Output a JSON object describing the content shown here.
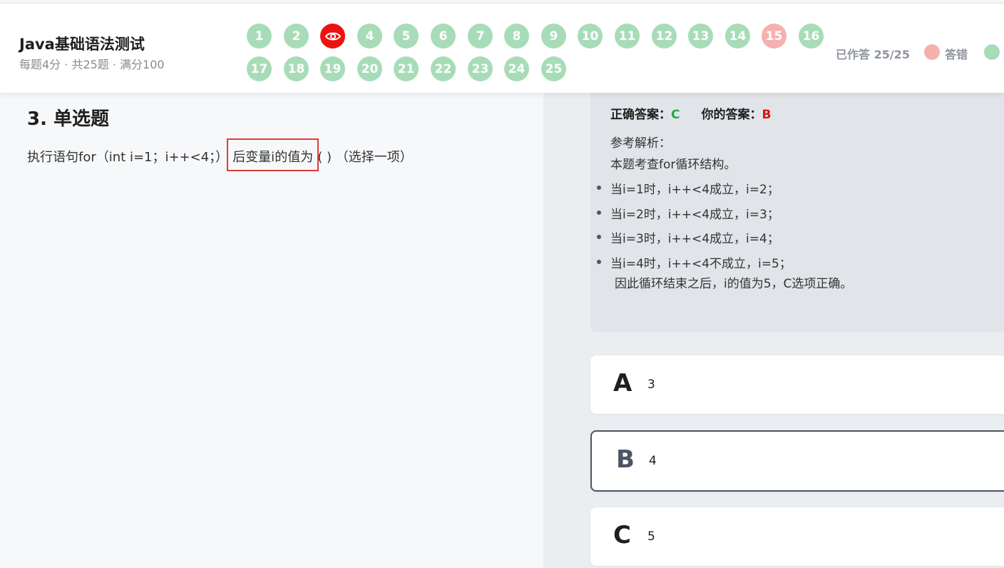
{
  "header": {
    "title": "Java基础语法测试",
    "subtitle": "每题4分 · 共25题 · 满分100",
    "answered": "已作答 25/25",
    "legend_wrong": "答错",
    "colors": {
      "correct": "#a8dcb8",
      "wrong": "#f5b0b0",
      "current": "#ee1111"
    }
  },
  "question_nav": [
    {
      "label": "1",
      "status": "correct"
    },
    {
      "label": "2",
      "status": "correct"
    },
    {
      "label": "",
      "status": "current",
      "icon": "eye-icon"
    },
    {
      "label": "4",
      "status": "correct"
    },
    {
      "label": "5",
      "status": "correct"
    },
    {
      "label": "6",
      "status": "correct"
    },
    {
      "label": "7",
      "status": "correct"
    },
    {
      "label": "8",
      "status": "correct"
    },
    {
      "label": "9",
      "status": "correct"
    },
    {
      "label": "10",
      "status": "correct"
    },
    {
      "label": "11",
      "status": "correct"
    },
    {
      "label": "12",
      "status": "correct"
    },
    {
      "label": "13",
      "status": "correct"
    },
    {
      "label": "14",
      "status": "correct"
    },
    {
      "label": "15",
      "status": "wrong"
    },
    {
      "label": "16",
      "status": "correct"
    },
    {
      "label": "17",
      "status": "correct"
    },
    {
      "label": "18",
      "status": "correct"
    },
    {
      "label": "19",
      "status": "correct"
    },
    {
      "label": "20",
      "status": "correct"
    },
    {
      "label": "21",
      "status": "correct"
    },
    {
      "label": "22",
      "status": "correct"
    },
    {
      "label": "23",
      "status": "correct"
    },
    {
      "label": "24",
      "status": "correct"
    },
    {
      "label": "25",
      "status": "correct"
    }
  ],
  "question": {
    "title": "3. 单选题",
    "stem_before": "执行语句for（int i=1；i++<4；）",
    "stem_highlight": "后变量i的值为",
    "stem_after": "( ) （选择一项）"
  },
  "analysis": {
    "correct_label": "正确答案：",
    "correct_value": "C",
    "user_label": "你的答案：",
    "user_value": "B",
    "head": "参考解析：",
    "intro": "本题考查for循环结构。",
    "steps": [
      "当i=1时，i++<4成立，i=2；",
      "当i=2时，i++<4成立，i=3；",
      "当i=3时，i++<4成立，i=4；",
      "当i=4时，i++<4不成立，i=5；"
    ],
    "conclusion": "因此循环结束之后，i的值为5，C选项正确。"
  },
  "options": [
    {
      "letter": "A",
      "text": "3"
    },
    {
      "letter": "B",
      "text": "4",
      "selected": true
    },
    {
      "letter": "C",
      "text": "5"
    }
  ]
}
